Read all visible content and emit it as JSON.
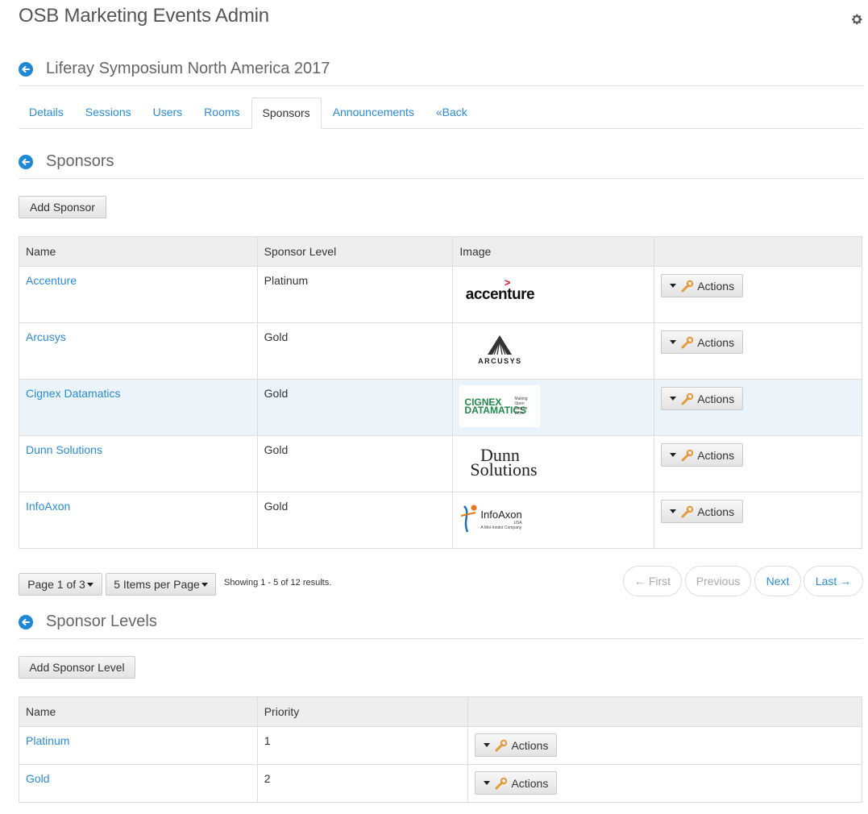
{
  "app": {
    "title": "OSB Marketing Events Admin"
  },
  "event": {
    "title": "Liferay Symposium North America 2017"
  },
  "tabs": [
    {
      "label": "Details"
    },
    {
      "label": "Sessions"
    },
    {
      "label": "Users"
    },
    {
      "label": "Rooms"
    },
    {
      "label": "Sponsors"
    },
    {
      "label": "Announcements"
    },
    {
      "label": "«Back"
    }
  ],
  "active_tab": "Sponsors",
  "sponsors": {
    "heading": "Sponsors",
    "add_label": "Add Sponsor",
    "columns": [
      "Name",
      "Sponsor Level",
      "Image",
      ""
    ],
    "rows": [
      {
        "name": "Accenture",
        "level": "Platinum",
        "logo": "accenture",
        "action": "Actions"
      },
      {
        "name": "Arcusys",
        "level": "Gold",
        "logo": "ARCUSYS",
        "action": "Actions"
      },
      {
        "name": "Cignex Datamatics",
        "level": "Gold",
        "logo": "CIGNEX DATAMATICS",
        "action": "Actions"
      },
      {
        "name": "Dunn Solutions",
        "level": "Gold",
        "logo": "Dunn Solutions",
        "action": "Actions"
      },
      {
        "name": "InfoAxon",
        "level": "Gold",
        "logo": "InfoAxon",
        "action": "Actions"
      }
    ],
    "logo_text": {
      "cignex_tag": "Making Open Source Work",
      "infoaxon_sub": "USA",
      "infoaxon_tag": "A Mol·Inndot Company"
    },
    "pagination": {
      "page_label": "Page 1 of 3",
      "per_page_label": "5 Items per Page",
      "showing": "Showing 1 - 5 of 12 results.",
      "first": "← First",
      "previous": "Previous",
      "next": "Next",
      "last": "Last →"
    }
  },
  "sponsor_levels": {
    "heading": "Sponsor Levels",
    "add_label": "Add Sponsor Level",
    "columns": [
      "Name",
      "Priority",
      ""
    ],
    "rows": [
      {
        "name": "Platinum",
        "priority": "1",
        "action": "Actions"
      },
      {
        "name": "Gold",
        "priority": "2",
        "action": "Actions"
      }
    ]
  },
  "colors": {
    "link": "#2b8bd6",
    "header_bg": "#eeeeee",
    "highlight_row": "#eaf4fa",
    "accenture_mark": "#e8102e"
  },
  "icons": {
    "settings": "gear-icon",
    "back": "back-arrow-icon",
    "action": "wrench-icon",
    "dropdown": "caret-down-icon"
  }
}
